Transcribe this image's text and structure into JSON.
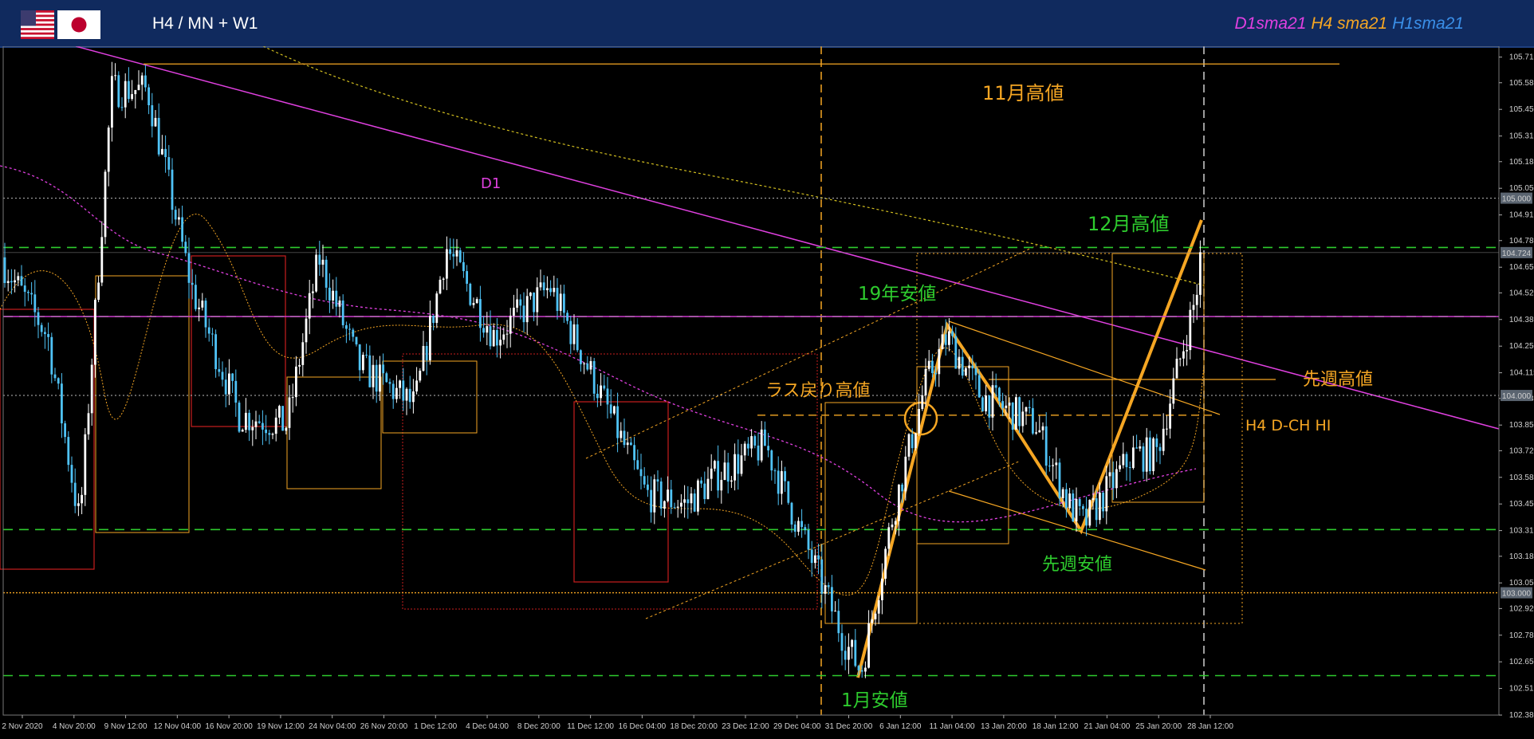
{
  "header": {
    "title": "H4 / MN + W1",
    "flags": [
      "us-flag-icon",
      "jp-flag-icon"
    ],
    "legend": [
      {
        "label": "D1sma21",
        "color": "#e040e0"
      },
      {
        "label": "H4 sma21",
        "color": "#f5a623"
      },
      {
        "label": "H1sma21",
        "color": "#3a8fe8"
      }
    ]
  },
  "chart": {
    "symbol_pair": "USD/JPY",
    "timeframe": "H4",
    "colors": {
      "background": "#000000",
      "bull_candle": "#ffffff",
      "bear_candle": "#4fc3f7",
      "green_levels": "#2ecc2e",
      "orange": "#f5a623",
      "magenta": "#e040e0",
      "red_boxes": "#c81e1e"
    },
    "price_axis": {
      "min": 102.38,
      "max": 105.77,
      "ticks": [
        "105.715",
        "105.585",
        "105.450",
        "105.315",
        "105.185",
        "105.050",
        "104.915",
        "104.785",
        "104.650",
        "104.520",
        "104.385",
        "104.250",
        "104.115",
        "103.985",
        "103.850",
        "103.720",
        "103.585",
        "103.450",
        "103.315",
        "103.185",
        "103.050",
        "102.920",
        "102.785",
        "102.650",
        "102.515",
        "102.380"
      ],
      "highlighted_labels": [
        {
          "text": "105.000",
          "price": 105.0
        },
        {
          "text": "104.724",
          "price": 104.724
        },
        {
          "text": "104.000",
          "price": 104.0
        },
        {
          "text": "103.000",
          "price": 103.0
        }
      ]
    },
    "time_axis": [
      "2 Nov 2020",
      "4 Nov 20:00",
      "9 Nov 12:00",
      "12 Nov 04:00",
      "16 Nov 20:00",
      "19 Nov 12:00",
      "24 Nov 04:00",
      "26 Nov 20:00",
      "1 Dec 12:00",
      "4 Dec 04:00",
      "8 Dec 20:00",
      "11 Dec 12:00",
      "16 Dec 04:00",
      "18 Dec 20:00",
      "23 Dec 12:00",
      "29 Dec 04:00",
      "31 Dec 20:00",
      "6 Jan 12:00",
      "11 Jan 04:00",
      "13 Jan 20:00",
      "18 Jan 12:00",
      "21 Jan 04:00",
      "25 Jan 20:00",
      "28 Jan 12:00"
    ],
    "annotations": {
      "nov_high": "11月高値",
      "dec_high": "12月高値",
      "y19_low": "19年安値",
      "last_pullback_high": "ラス戻り高値",
      "last_week_high": "先週高値",
      "h4_dch_hi": "H4 D-CH HI",
      "last_week_low": "先週安値",
      "jan_low": "1月安値",
      "d1_label": "D1"
    },
    "levels": {
      "nov_high": 105.68,
      "dec_high_green": 104.75,
      "y19_low_green": 104.4,
      "magenta_horizontal": 104.4,
      "pullback_high_dash": 103.9,
      "last_week_low_green": 103.32,
      "jan_low_green": 102.58,
      "dotted_105": 105.0,
      "dotted_104": 104.0,
      "dotted_103": 103.0
    }
  }
}
